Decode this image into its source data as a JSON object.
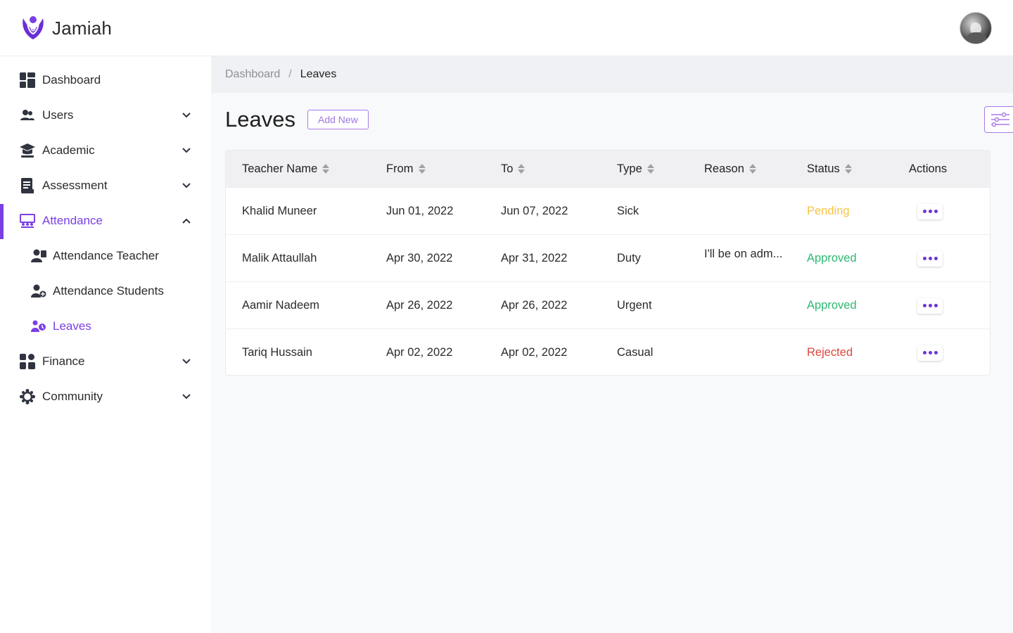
{
  "app": {
    "brand": "Jamiah",
    "accent_color": "#7b3fe4"
  },
  "sidebar": {
    "items": [
      {
        "label": "Dashboard",
        "icon": "dashboard-icon"
      },
      {
        "label": "Users",
        "icon": "users-icon"
      },
      {
        "label": "Academic",
        "icon": "graduation-cap-icon"
      },
      {
        "label": "Assessment",
        "icon": "clipboard-icon"
      },
      {
        "label": "Attendance",
        "icon": "classroom-icon"
      },
      {
        "label": "Attendance Teacher",
        "icon": "teacher-icon"
      },
      {
        "label": "Attendance Students",
        "icon": "student-icon"
      },
      {
        "label": "Leaves",
        "icon": "leaves-icon"
      },
      {
        "label": "Finance",
        "icon": "finance-icon"
      },
      {
        "label": "Community",
        "icon": "community-icon"
      }
    ]
  },
  "breadcrumb": {
    "parent": "Dashboard",
    "separator": "/",
    "current": "Leaves"
  },
  "page": {
    "title": "Leaves",
    "add_new_label": "Add New"
  },
  "table": {
    "headers": [
      "Teacher Name",
      "From",
      "To",
      "Type",
      "Reason",
      "Status",
      "Actions"
    ],
    "rows": [
      {
        "name": "Khalid Muneer",
        "from": "Jun 01, 2022",
        "to": "Jun 07, 2022",
        "type": "Sick",
        "reason": "",
        "status": "Pending",
        "status_color": "#f6c343"
      },
      {
        "name": "Malik Attaullah",
        "from": "Apr 30, 2022",
        "to": "Apr 31, 2022",
        "type": "Duty",
        "reason": "I'll be on adm...",
        "status": "Approved",
        "status_color": "#2eb872"
      },
      {
        "name": "Aamir Nadeem",
        "from": "Apr 26, 2022",
        "to": "Apr 26, 2022",
        "type": "Urgent",
        "reason": "",
        "status": "Approved",
        "status_color": "#2eb872"
      },
      {
        "name": "Tariq Hussain",
        "from": "Apr 02, 2022",
        "to": "Apr 02, 2022",
        "type": "Casual",
        "reason": "",
        "status": "Rejected",
        "status_color": "#e0443e"
      }
    ]
  }
}
